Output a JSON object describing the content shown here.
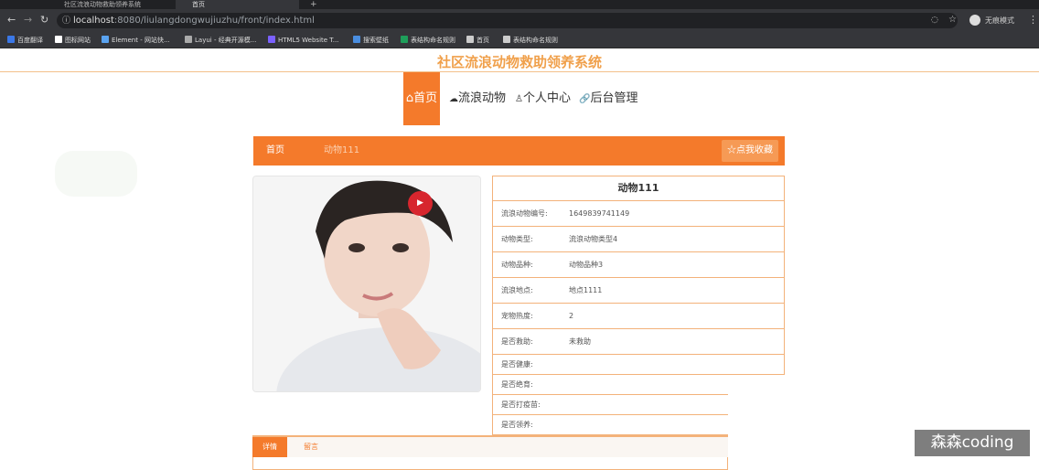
{
  "browser": {
    "tabs": [
      {
        "title": "社区流浪动物救助领养系统"
      },
      {
        "title": "首页"
      }
    ],
    "new_tab": "+",
    "url_host": "localhost",
    "url_path": ":8080/liulangdongwujiuzhu/front/index.html",
    "profile_label": "无痕模式",
    "bookmarks": [
      {
        "label": "百度翻译",
        "color": "#3b78e7"
      },
      {
        "label": "图标网站",
        "color": "#ffffff"
      },
      {
        "label": "Element - 网站快...",
        "color": "#5aa3f0"
      },
      {
        "label": "Layui - 经典开源模...",
        "color": "#aaaaaa"
      },
      {
        "label": "HTML5 Website T...",
        "color": "#7b61ff"
      },
      {
        "label": "搜索壁纸",
        "color": "#4a8ee0"
      },
      {
        "label": "表结构命名规则",
        "color": "#1e9e5a"
      },
      {
        "label": "首页",
        "color": "#cccccc"
      },
      {
        "label": "表结构命名规则",
        "color": "#cccccc"
      }
    ]
  },
  "site": {
    "title": "社区流浪动物救助领养系统",
    "accent": "#f47a2b",
    "nav": [
      {
        "label": "首页",
        "icon": "home-icon",
        "active": true
      },
      {
        "label": "流浪动物",
        "icon": "cloud-icon"
      },
      {
        "label": "个人中心",
        "icon": "user-icon"
      },
      {
        "label": "后台管理",
        "icon": "link-icon"
      }
    ]
  },
  "breadcrumb": {
    "home": "首页",
    "current": "动物111",
    "favorite_label": "点我收藏"
  },
  "detail": {
    "name": "动物111",
    "rows": [
      {
        "label": "流浪动物编号:",
        "value": "1649839741149"
      },
      {
        "label": "动物类型:",
        "value": "流浪动物类型4"
      },
      {
        "label": "动物品种:",
        "value": "动物品种3"
      },
      {
        "label": "流浪地点:",
        "value": "地点1111"
      },
      {
        "label": "宠物热度:",
        "value": "2"
      },
      {
        "label": "是否救助:",
        "value": "未救助"
      },
      {
        "label": "是否健康:",
        "value": ""
      },
      {
        "label": "是否绝育:",
        "value": ""
      },
      {
        "label": "是否打疫苗:",
        "value": ""
      },
      {
        "label": "是否领养:",
        "value": ""
      }
    ]
  },
  "tabs": {
    "detail": "详情",
    "message": "留言"
  },
  "watermark": "森森coding"
}
